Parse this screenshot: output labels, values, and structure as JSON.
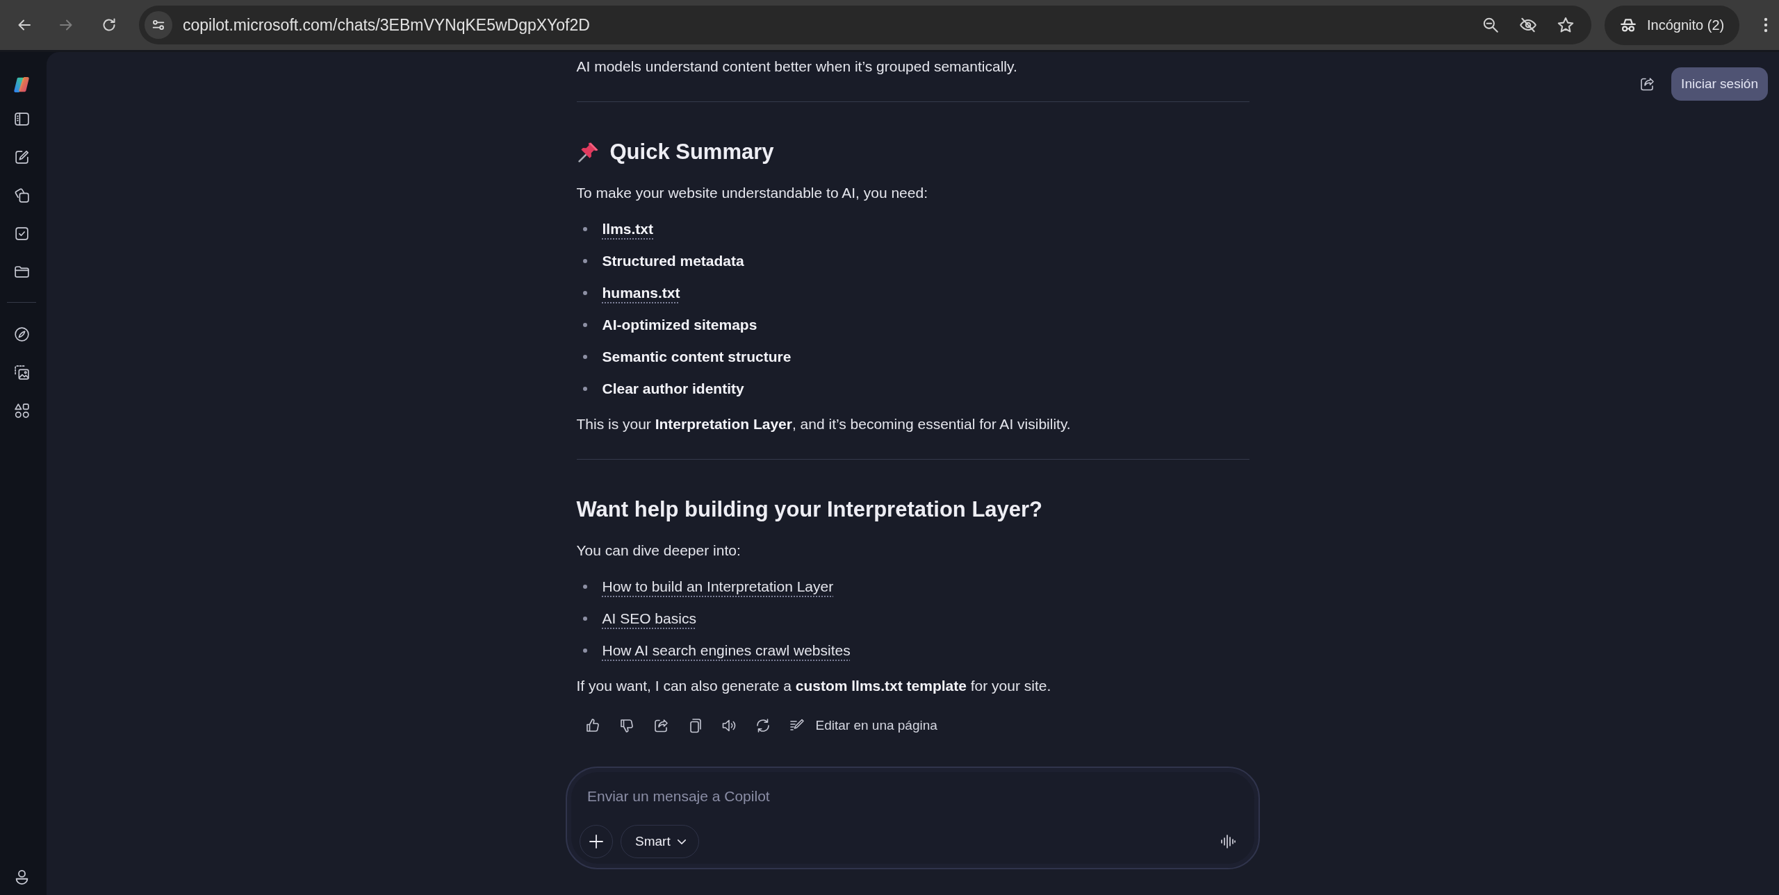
{
  "browser": {
    "back_disabled": false,
    "forward_disabled": true,
    "url": "copilot.microsoft.com/chats/3EBmVYNqKE5wDgpXYof2D",
    "profile": "Incógnito (2)"
  },
  "header": {
    "sign_in": "Iniciar sesión"
  },
  "message": {
    "blocks": [
      {
        "kind": "paragraph",
        "text": "AI models understand content better when it’s grouped semantically."
      },
      {
        "kind": "rule"
      },
      {
        "kind": "heading",
        "icon": true,
        "text": "Quick Summary"
      },
      {
        "kind": "paragraph",
        "text": "To make your website understandable to AI, you need:"
      },
      {
        "kind": "list",
        "strong": true,
        "items": [
          {
            "text": "llms.txt",
            "link": true
          },
          {
            "text": "Structured metadata",
            "link": false
          },
          {
            "text": "humans.txt",
            "link": true
          },
          {
            "text": "AI-optimized sitemaps",
            "link": false
          },
          {
            "text": "Semantic content structure",
            "link": false
          },
          {
            "text": "Clear author identity",
            "link": false
          }
        ]
      },
      {
        "kind": "paragraph",
        "text": "This is your **Interpretation Layer**, and it’s becoming essential for AI visibility."
      },
      {
        "kind": "rule"
      },
      {
        "kind": "heading",
        "icon": false,
        "text": "Want help building your Interpretation Layer?"
      },
      {
        "kind": "paragraph",
        "text": "You can dive deeper into:"
      },
      {
        "kind": "list",
        "strong": false,
        "items": [
          {
            "text": "How to build an Interpretation Layer",
            "link": true
          },
          {
            "text": "AI SEO basics",
            "link": true
          },
          {
            "text": "How AI search engines crawl websites",
            "link": true
          }
        ]
      },
      {
        "kind": "paragraph",
        "text": "If you want, I can also generate a **custom llms.txt template** for your site."
      }
    ],
    "edit_label": "Editar en una página"
  },
  "composer": {
    "placeholder": "Enviar un mensaje a Copilot",
    "mode": "Smart"
  }
}
